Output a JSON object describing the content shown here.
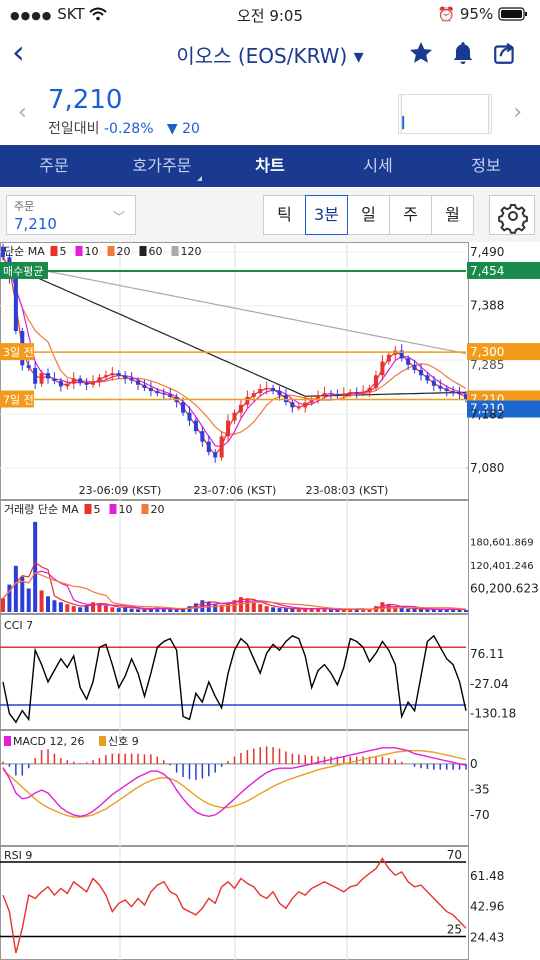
{
  "status_bar": {
    "carrier": "SKT",
    "time": "오전 9:05",
    "battery": "95%"
  },
  "header": {
    "title": "이오스 (EOS/KRW)",
    "title_caret": "▾"
  },
  "price": {
    "current": "7,210",
    "change_label": "전일대비",
    "change_pct": "-0.28%",
    "change_abs": "20",
    "change_arrow": "▼"
  },
  "tabs": [
    "주문",
    "호가주문",
    "차트",
    "시세",
    "정보"
  ],
  "active_tab": "차트",
  "order_box": {
    "label": "주문",
    "value": "7,210"
  },
  "periods": [
    "틱",
    "3분",
    "일",
    "주",
    "월"
  ],
  "active_period": "3분",
  "colors": {
    "up": "#e8322d",
    "down": "#2b3ed8",
    "brand": "#1a3a8f",
    "price_blue": "#1c5fd0",
    "orange": "#f29b1a",
    "green": "#1a8a4a"
  },
  "chart_data": [
    {
      "type": "candlestick",
      "name": "price",
      "legend_prefix": "단순 MA",
      "legend": [
        {
          "name": "5",
          "color": "#e8322d"
        },
        {
          "name": "10",
          "color": "#e020d8"
        },
        {
          "name": "20",
          "color": "#f07a3a"
        },
        {
          "name": "60",
          "color": "#222222"
        },
        {
          "name": "120",
          "color": "#aaaaaa"
        }
      ],
      "x_ticks": [
        "23-06:09 (KST)",
        "23-07:06 (KST)",
        "23-08:03 (KST)"
      ],
      "y_ticks": [
        "7,490",
        "7,388",
        "7,285",
        "7,182",
        "7,080"
      ],
      "ylim": [
        7080,
        7490
      ],
      "levels": [
        {
          "label": "매수평균",
          "value": 7454,
          "tag": "7,454",
          "color": "#1a8a4a"
        },
        {
          "label": "3일 전",
          "value": 7300,
          "tag": "7,300",
          "color": "#f29b1a"
        },
        {
          "label": "7일 전",
          "value": 7210,
          "tag": "7,210",
          "color": "#f29b1a"
        }
      ],
      "current_price_tag": "7,210",
      "close": [
        7480,
        7440,
        7340,
        7275,
        7270,
        7240,
        7260,
        7250,
        7245,
        7235,
        7240,
        7250,
        7242,
        7238,
        7244,
        7252,
        7256,
        7260,
        7255,
        7250,
        7246,
        7238,
        7232,
        7226,
        7222,
        7220,
        7215,
        7205,
        7185,
        7170,
        7150,
        7130,
        7110,
        7100,
        7140,
        7170,
        7185,
        7200,
        7215,
        7222,
        7230,
        7232,
        7226,
        7218,
        7205,
        7195,
        7195,
        7204,
        7212,
        7218,
        7222,
        7220,
        7218,
        7221,
        7224,
        7222,
        7225,
        7232,
        7256,
        7282,
        7295,
        7303,
        7288,
        7276,
        7266,
        7256,
        7246,
        7236,
        7231,
        7226,
        7222,
        7220,
        7210
      ]
    },
    {
      "type": "bar",
      "name": "volume",
      "legend_prefix": "거래량 단순 MA",
      "legend": [
        {
          "name": "5",
          "color": "#e8322d"
        },
        {
          "name": "10",
          "color": "#e020d8"
        },
        {
          "name": "20",
          "color": "#f07a3a"
        }
      ],
      "y_ticks": [
        "180,601.869",
        "120,401.246",
        "60,200.623"
      ],
      "ylim": [
        0,
        240000
      ],
      "values": [
        35000,
        70000,
        118000,
        90000,
        60000,
        230000,
        55000,
        40000,
        30000,
        25000,
        20000,
        15000,
        12000,
        18000,
        25000,
        22000,
        16000,
        12000,
        10000,
        14000,
        8000,
        7000,
        6000,
        9000,
        11000,
        8000,
        7000,
        6000,
        9000,
        15000,
        22000,
        30000,
        26000,
        20000,
        18000,
        24000,
        30000,
        38000,
        32000,
        26000,
        20000,
        15000,
        12000,
        10000,
        9000,
        8000,
        7000,
        8000,
        10000,
        9000,
        7000,
        6000,
        5000,
        7000,
        9000,
        8000,
        7000,
        6000,
        15000,
        25000,
        18000,
        12000,
        10000,
        8000,
        9000,
        7000,
        6000,
        8000,
        7000,
        6000,
        8000,
        6000,
        5000
      ]
    },
    {
      "type": "line",
      "name": "cci",
      "legend": [
        {
          "name": "CCI 7",
          "color": "#000000"
        }
      ],
      "y_ticks": [
        "76.11",
        "-27.04",
        "-130.18"
      ],
      "levels": [
        {
          "value": 100,
          "color": "#e8322d"
        },
        {
          "value": -100,
          "color": "#2b3ed8"
        }
      ],
      "ylim": [
        -180,
        160
      ],
      "values": [
        -20,
        -130,
        -160,
        -120,
        -150,
        90,
        40,
        -20,
        20,
        60,
        30,
        70,
        -40,
        -80,
        -20,
        100,
        110,
        40,
        -40,
        0,
        60,
        10,
        -70,
        10,
        100,
        120,
        130,
        90,
        -140,
        -150,
        -60,
        -90,
        -20,
        -70,
        -110,
        10,
        90,
        130,
        110,
        60,
        10,
        80,
        110,
        90,
        120,
        140,
        130,
        70,
        -40,
        20,
        40,
        10,
        -30,
        30,
        130,
        120,
        100,
        50,
        80,
        120,
        90,
        40,
        -140,
        -90,
        -120,
        0,
        120,
        140,
        100,
        60,
        40,
        -20,
        -120
      ]
    },
    {
      "type": "line",
      "name": "macd",
      "legend": [
        {
          "name": "MACD 12, 26",
          "color": "#e020d8"
        },
        {
          "name": "신호 9",
          "color": "#e8a020"
        }
      ],
      "y_ticks": [
        "0",
        "-35",
        "-70"
      ],
      "ylim": [
        -110,
        30
      ],
      "macd": [
        -5,
        -20,
        -40,
        -48,
        -46,
        -40,
        -36,
        -40,
        -50,
        -60,
        -66,
        -70,
        -72,
        -70,
        -65,
        -58,
        -50,
        -42,
        -36,
        -30,
        -24,
        -18,
        -14,
        -10,
        -10,
        -14,
        -22,
        -36,
        -48,
        -58,
        -66,
        -70,
        -72,
        -70,
        -64,
        -56,
        -48,
        -40,
        -32,
        -25,
        -18,
        -12,
        -8,
        -6,
        -6,
        -6,
        -4,
        -2,
        0,
        2,
        4,
        6,
        8,
        10,
        12,
        14,
        16,
        18,
        20,
        22,
        22,
        22,
        20,
        18,
        14,
        12,
        10,
        8,
        6,
        4,
        2,
        0,
        -2
      ],
      "signal": [
        -8,
        -16,
        -24,
        -32,
        -40,
        -48,
        -55,
        -60,
        -64,
        -68,
        -71,
        -73,
        -73,
        -72,
        -70,
        -66,
        -62,
        -56,
        -50,
        -44,
        -38,
        -32,
        -27,
        -23,
        -20,
        -19,
        -20,
        -24,
        -30,
        -37,
        -44,
        -50,
        -55,
        -58,
        -60,
        -60,
        -58,
        -55,
        -51,
        -46,
        -41,
        -36,
        -31,
        -27,
        -23,
        -20,
        -17,
        -14,
        -11,
        -8,
        -6,
        -4,
        -2,
        0,
        2,
        4,
        6,
        8,
        10,
        12,
        14,
        16,
        17,
        18,
        18,
        18,
        17,
        16,
        14,
        12,
        10,
        8,
        6
      ]
    },
    {
      "type": "line",
      "name": "rsi",
      "legend": [
        {
          "name": "RSI 9",
          "color": "#e8322d"
        }
      ],
      "y_ticks": [
        "70",
        "61.48",
        "42.96",
        "24.43"
      ],
      "band_labels": [
        "70",
        "25"
      ],
      "levels": [
        {
          "value": 70,
          "color": "#000000"
        },
        {
          "value": 25,
          "color": "#000000"
        }
      ],
      "ylim": [
        12,
        76
      ],
      "values": [
        50,
        40,
        15,
        30,
        50,
        48,
        52,
        55,
        50,
        54,
        51,
        58,
        55,
        52,
        60,
        56,
        50,
        40,
        45,
        47,
        43,
        48,
        44,
        52,
        56,
        58,
        52,
        50,
        42,
        40,
        38,
        42,
        48,
        45,
        55,
        58,
        54,
        60,
        57,
        55,
        50,
        48,
        52,
        45,
        42,
        48,
        52,
        50,
        54,
        56,
        58,
        56,
        54,
        52,
        55,
        56,
        60,
        63,
        66,
        72,
        66,
        62,
        64,
        58,
        55,
        56,
        52,
        48,
        44,
        40,
        38,
        34,
        30
      ]
    }
  ]
}
